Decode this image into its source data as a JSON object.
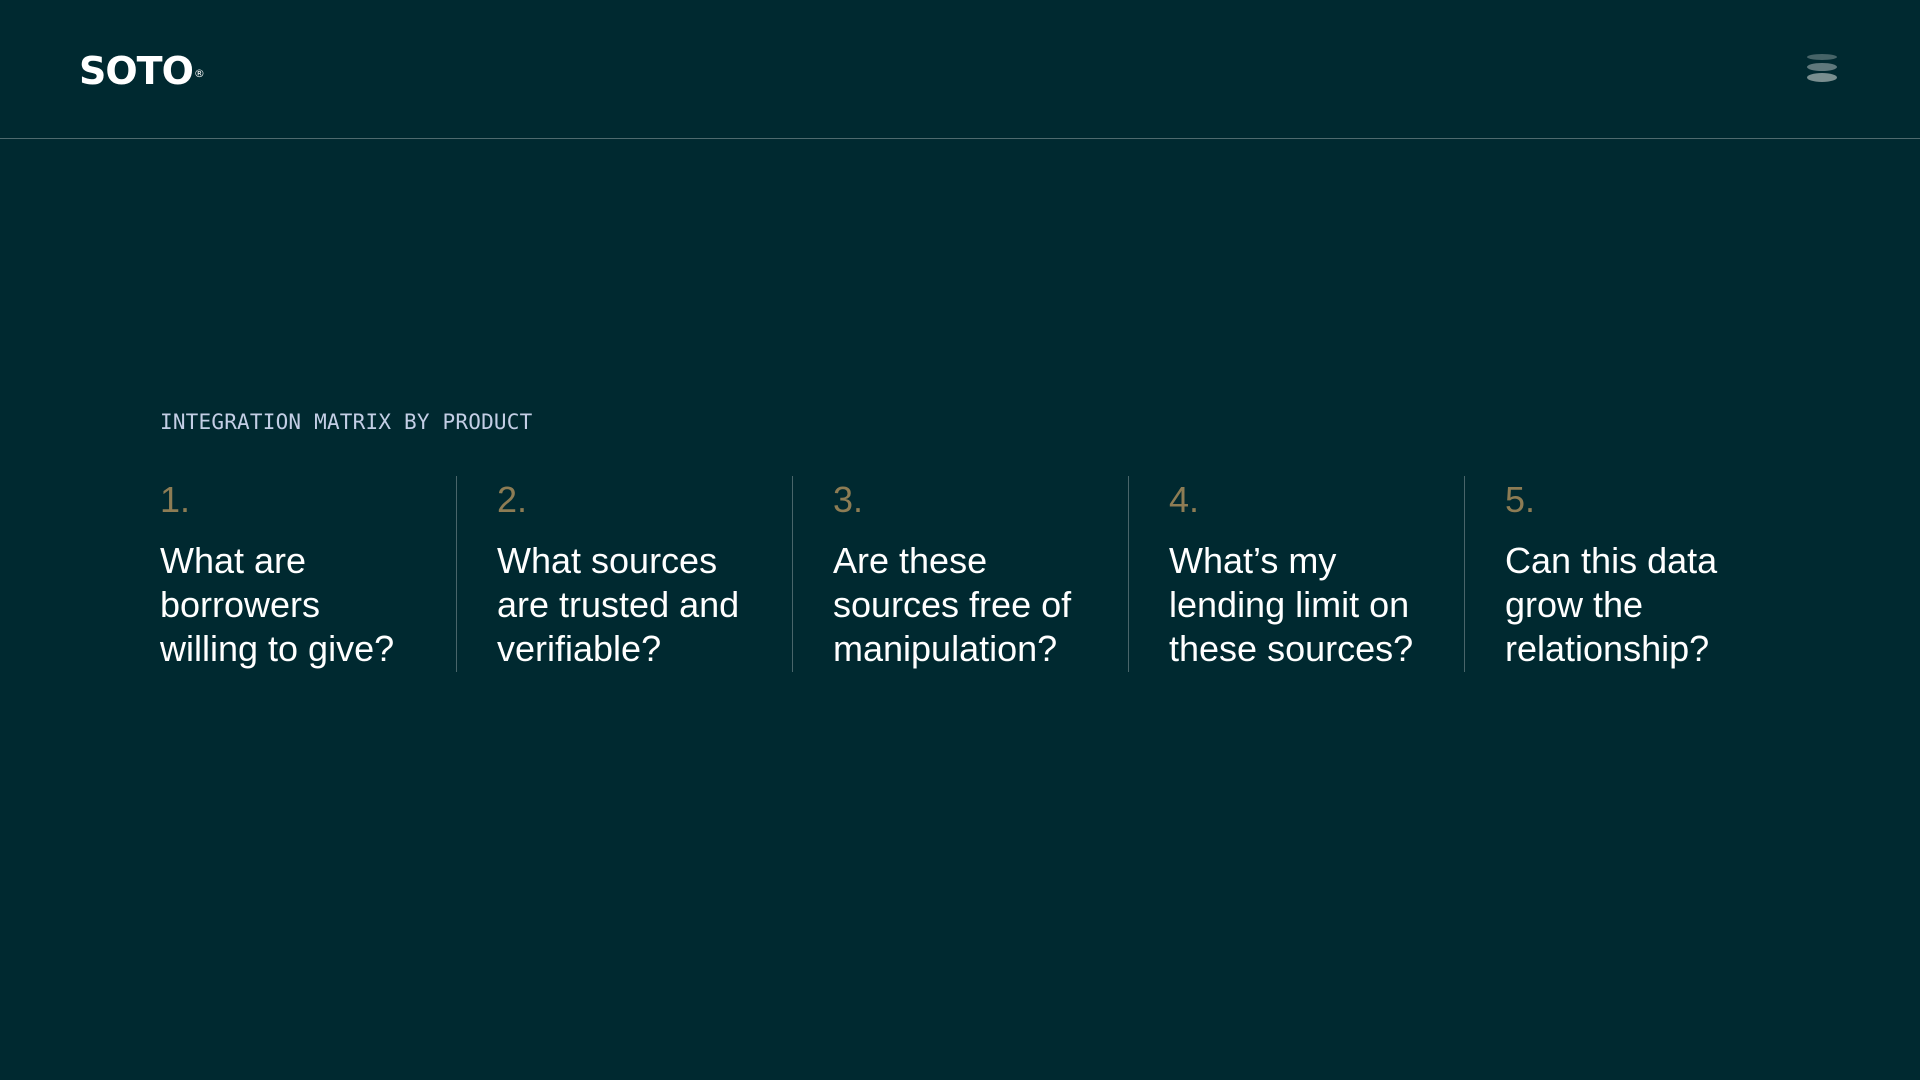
{
  "header": {
    "logo": "SOTO",
    "logo_mark": "®",
    "menu_icon": "menu-icon"
  },
  "section": {
    "eyebrow": "INTEGRATION MATRIX BY PRODUCT"
  },
  "questions": [
    {
      "number": "1.",
      "text": "What are\nborrowers\nwilling to give?"
    },
    {
      "number": "2.",
      "text": "What sources\nare trusted and\nverifiable?"
    },
    {
      "number": "3.",
      "text": "Are these\nsources free of\nmanipulation?"
    },
    {
      "number": "4.",
      "text": "What’s my\nlending limit on\nthese sources?"
    },
    {
      "number": "5.",
      "text": "Can this data\ngrow the\nrelationship?"
    }
  ],
  "colors": {
    "background": "#002930",
    "accent_number": "#8d7c54",
    "eyebrow": "#c3cee5",
    "divider": "#49656a"
  }
}
